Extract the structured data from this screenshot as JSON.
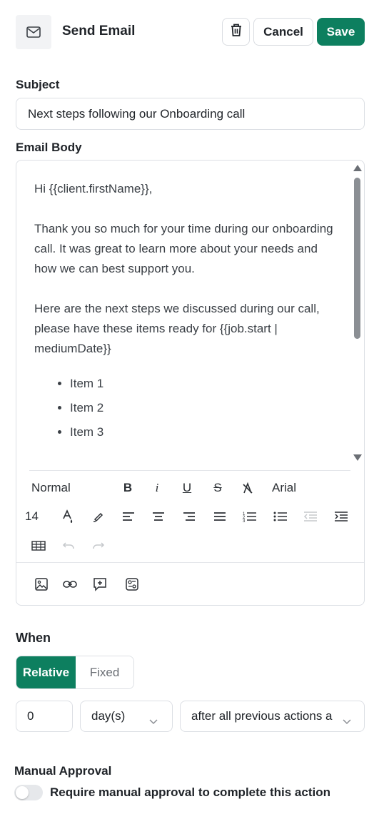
{
  "header": {
    "title": "Send Email",
    "icon": "mail-icon",
    "cancel_label": "Cancel",
    "save_label": "Save",
    "delete_icon": "trash-icon"
  },
  "subject": {
    "label": "Subject",
    "value": "Next steps following our Onboarding call"
  },
  "email_body": {
    "label": "Email Body",
    "greeting": "Hi {{client.firstName}},",
    "paragraph_1": "Thank you so much for your time during our onboarding call. It was great to learn more about your needs and how we can best support you.",
    "paragraph_2": "Here are the next steps we discussed during our call, please have these items ready for {{job.start | mediumDate}}",
    "items": [
      "Item 1",
      "Item 2",
      "Item 3"
    ]
  },
  "toolbar": {
    "paragraph_style": "Normal",
    "font_family": "Arial",
    "font_size": "14"
  },
  "when": {
    "label": "When",
    "mode_relative": "Relative",
    "mode_fixed": "Fixed",
    "selected_mode": "Relative",
    "offset_value": "0",
    "unit_value": "day(s)",
    "anchor_value": "after all previous actions a"
  },
  "approval": {
    "label": "Manual Approval",
    "toggle_label": "Require manual approval to complete this action",
    "enabled": false
  },
  "colors": {
    "accent": "#0d7f5f",
    "border": "#dcdfe4"
  }
}
